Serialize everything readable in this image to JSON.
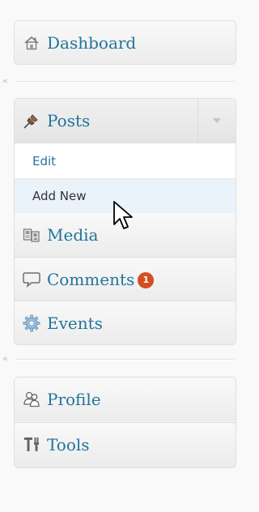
{
  "menu": {
    "dashboard": {
      "label": "Dashboard",
      "icon": "home-icon"
    },
    "posts": {
      "label": "Posts",
      "icon": "pushpin-icon",
      "submenu": [
        {
          "label": "Edit"
        },
        {
          "label": "Add New"
        }
      ]
    },
    "media": {
      "label": "Media",
      "icon": "media-icon"
    },
    "comments": {
      "label": "Comments",
      "icon": "speech-bubble-icon",
      "badge": "1"
    },
    "events": {
      "label": "Events",
      "icon": "gear-icon"
    },
    "profile": {
      "label": "Profile",
      "icon": "users-icon"
    },
    "tools": {
      "label": "Tools",
      "icon": "tools-icon"
    }
  },
  "separators": [
    "«",
    "«"
  ],
  "colors": {
    "link": "#21759b",
    "badge": "#d54e21",
    "active_submenu": "#eaf2fa"
  }
}
